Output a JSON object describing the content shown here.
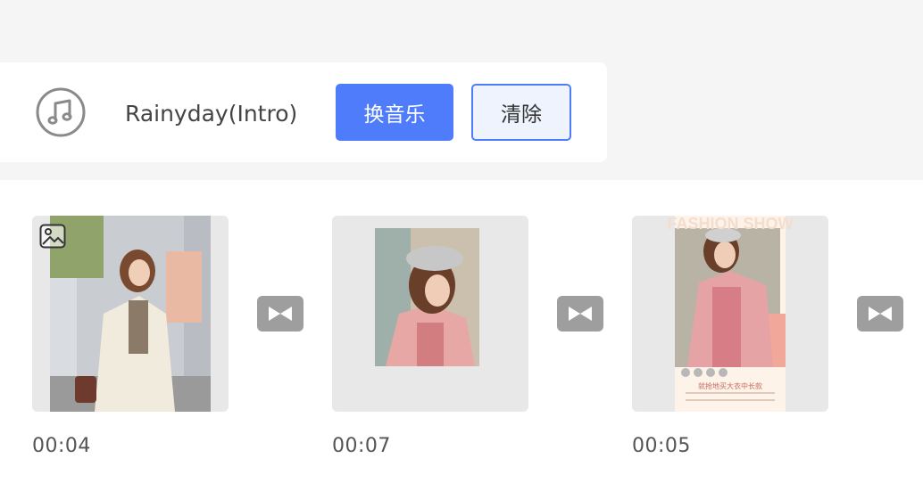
{
  "music_bar": {
    "song_title": "Rainyday(Intro)",
    "change_music_label": "换音乐",
    "clear_label": "清除",
    "icon": "music-note-icon"
  },
  "clips": [
    {
      "duration": "00:04",
      "thumbnail": "woman-in-beige-coat-street-photo",
      "badge_icon": "image-icon"
    },
    {
      "duration": "00:07",
      "thumbnail": "woman-in-beret-and-pink-sweater-photo"
    },
    {
      "duration": "00:05",
      "thumbnail": "fashion-show-poster-photo",
      "poster_heading": "FASHION SHOW",
      "poster_caption": "就抢地买大衣中长款"
    }
  ],
  "transition_icon": "bowtie-transition-icon",
  "colors": {
    "accent": "#4e7cfa",
    "top_background": "#f5f5f5",
    "clip_background": "#e8e8e8",
    "transition_button": "#9e9e9e"
  }
}
